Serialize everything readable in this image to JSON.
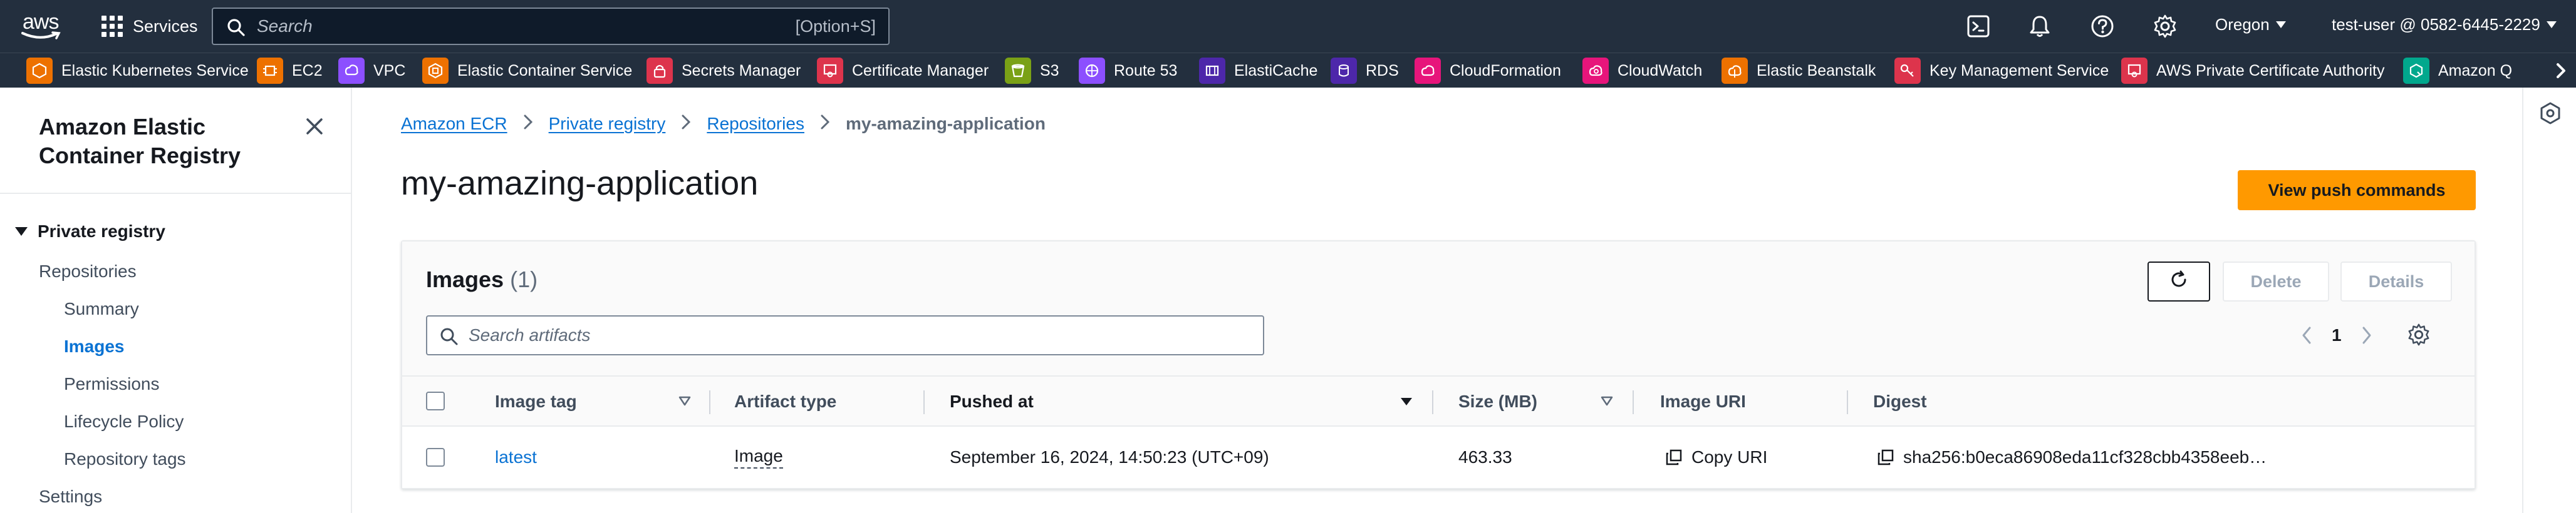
{
  "topnav": {
    "logo_text": "aws",
    "services_label": "Services",
    "search_placeholder": "Search",
    "search_shortcut": "[Option+S]",
    "region": "Oregon",
    "user": "test-user @ 0582-6445-2229"
  },
  "favorites": [
    {
      "label": "Elastic Kubernetes Service",
      "color": "#ed7100"
    },
    {
      "label": "EC2",
      "color": "#ed7100"
    },
    {
      "label": "VPC",
      "color": "#8c4fff"
    },
    {
      "label": "Elastic Container Service",
      "color": "#ed7100"
    },
    {
      "label": "Secrets Manager",
      "color": "#dd344c"
    },
    {
      "label": "Certificate Manager",
      "color": "#dd344c"
    },
    {
      "label": "S3",
      "color": "#7aa116"
    },
    {
      "label": "Route 53",
      "color": "#8c4fff"
    },
    {
      "label": "ElastiCache",
      "color": "#4d27aa"
    },
    {
      "label": "RDS",
      "color": "#4d27aa"
    },
    {
      "label": "CloudFormation",
      "color": "#e7157b"
    },
    {
      "label": "CloudWatch",
      "color": "#e7157b"
    },
    {
      "label": "Elastic Beanstalk",
      "color": "#ed7100"
    },
    {
      "label": "Key Management Service",
      "color": "#dd344c"
    },
    {
      "label": "AWS Private Certificate Authority",
      "color": "#dd344c"
    },
    {
      "label": "Amazon Q",
      "color": "#01a88d"
    }
  ],
  "sidenav": {
    "title": "Amazon Elastic Container Registry",
    "section": "Private registry",
    "items": [
      {
        "label": "Repositories"
      },
      {
        "label": "Summary"
      },
      {
        "label": "Images"
      },
      {
        "label": "Permissions"
      },
      {
        "label": "Lifecycle Policy"
      },
      {
        "label": "Repository tags"
      },
      {
        "label": "Settings"
      }
    ]
  },
  "breadcrumb": {
    "items": [
      "Amazon ECR",
      "Private registry",
      "Repositories"
    ],
    "current": "my-amazing-application"
  },
  "page": {
    "title": "my-amazing-application",
    "push_button": "View push commands"
  },
  "images_panel": {
    "title": "Images",
    "count": "(1)",
    "delete_label": "Delete",
    "details_label": "Details",
    "search_placeholder": "Search artifacts",
    "page_number": "1",
    "columns": {
      "image_tag": "Image tag",
      "artifact_type": "Artifact type",
      "pushed_at": "Pushed at",
      "size": "Size (MB)",
      "image_uri": "Image URI",
      "digest": "Digest"
    },
    "rows": [
      {
        "image_tag": "latest",
        "artifact_type": "Image",
        "pushed_at": "September 16, 2024, 14:50:23 (UTC+09)",
        "size": "463.33",
        "image_uri": "Copy URI",
        "digest": "sha256:b0eca86908eda11cf328cbb4358eeb…"
      }
    ]
  },
  "colors": {
    "nav_bg": "#232f3e",
    "link": "#0972d3",
    "primary_button": "#ff9900"
  }
}
